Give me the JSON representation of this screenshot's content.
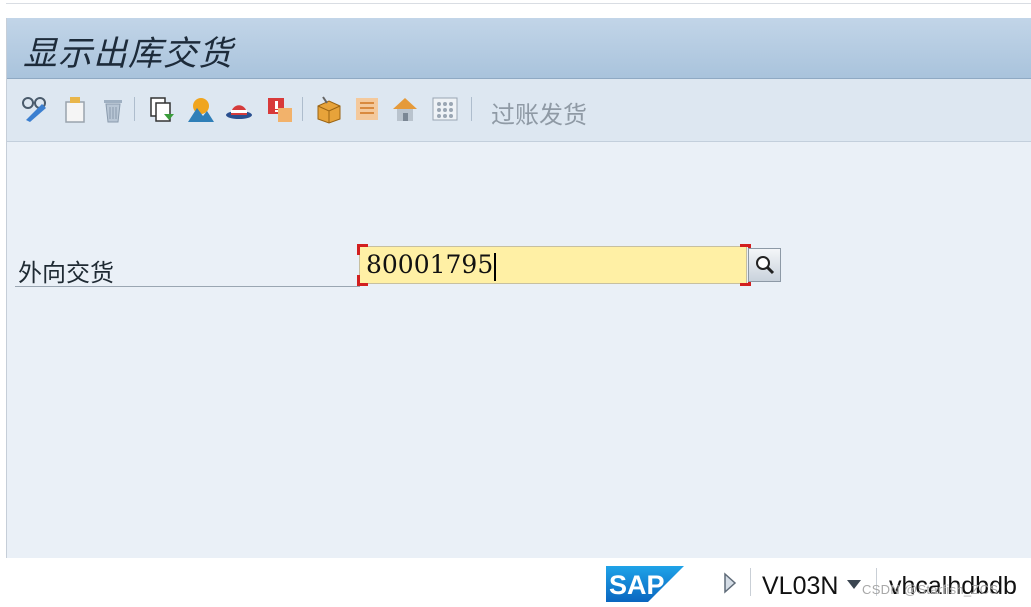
{
  "window": {
    "title": "显示出库交货"
  },
  "toolbar": {
    "buttons": [
      {
        "name": "display-change-icon"
      },
      {
        "name": "create-icon"
      },
      {
        "name": "delete-icon"
      },
      {
        "name": "copy-document-icon"
      },
      {
        "name": "landscape-icon"
      },
      {
        "name": "hat-icon"
      },
      {
        "name": "alert-icon"
      },
      {
        "name": "package-icon"
      },
      {
        "name": "list-icon"
      },
      {
        "name": "house-icon"
      },
      {
        "name": "grid-icon"
      }
    ],
    "post_goods_issue_label": "过账发货"
  },
  "form": {
    "outbound_delivery_label": "外向交货",
    "outbound_delivery_value": "80001795"
  },
  "status_bar": {
    "sap_logo_text": "SAP",
    "transaction_code": "VL03N",
    "host": "vhcalhdbdb",
    "watermark": "CSDN @Starfish_ZCS"
  }
}
